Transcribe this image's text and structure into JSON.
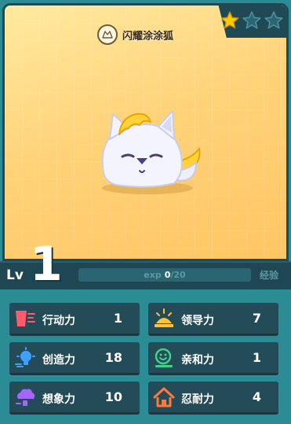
{
  "pet": {
    "name": "闪耀涂涂狐",
    "stars_filled": 1,
    "stars_total": 3
  },
  "level": {
    "label": "Lv",
    "value": "1"
  },
  "exp": {
    "label": "exp",
    "current": "0",
    "max_text": "/20",
    "progress": 0,
    "button_label": "经验"
  },
  "stats": [
    {
      "label": "行动力",
      "value": "1",
      "icon": "running-flag-icon",
      "color": "#ff5a6e"
    },
    {
      "label": "领导力",
      "value": "7",
      "icon": "sun-rising-icon",
      "color": "#ffc23a"
    },
    {
      "label": "创造力",
      "value": "18",
      "icon": "lightbulb-icon",
      "color": "#3fa0ff"
    },
    {
      "label": "亲和力",
      "value": "1",
      "icon": "smiley-face-icon",
      "color": "#3fd28a"
    },
    {
      "label": "想象力",
      "value": "10",
      "icon": "cloud-dream-icon",
      "color": "#a565ff"
    },
    {
      "label": "忍耐力",
      "value": "4",
      "icon": "house-shield-icon",
      "color": "#ff7a3a"
    }
  ],
  "colors": {
    "frame": "#2c8c95",
    "panel": "#234b58",
    "card_bg": "#ffd37a",
    "star_filled": "#ffcc00",
    "star_empty": "#1f4a55"
  }
}
